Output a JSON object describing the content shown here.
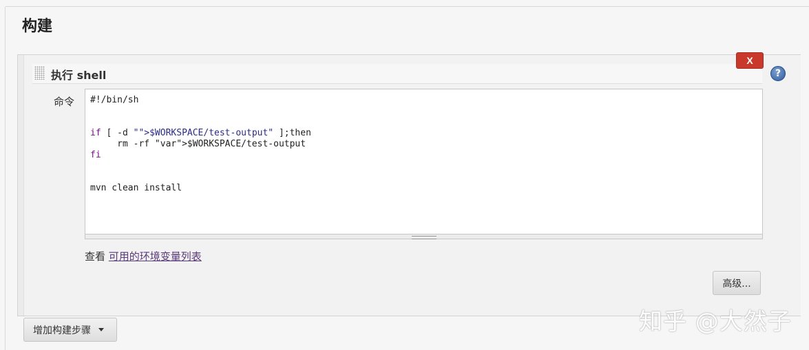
{
  "section": {
    "title": "构建"
  },
  "step": {
    "title": "执行 shell",
    "delete_label": "X",
    "help_label": "?",
    "command_label": "命令",
    "command_lines": [
      "#!/bin/sh",
      "",
      "",
      "if [ -d \"$WORKSPACE/test-output\" ];then",
      "     rm -rf $WORKSPACE/test-output",
      "fi",
      "",
      "",
      "mvn clean install"
    ],
    "env_prefix": "查看",
    "env_link": "可用的环境变量列表",
    "advanced_label": "高级..."
  },
  "add_step": {
    "label": "增加构建步骤"
  },
  "watermark": "知乎 @大然子",
  "colors": {
    "delete_button": "#c8392b",
    "help_icon": "#2e5c9e",
    "link": "#5b3a7a",
    "keyword": "#7a0e8a"
  },
  "icons": {
    "help": "question-circle-icon",
    "drag": "drag-handle-icon",
    "dropdown": "caret-down-icon"
  }
}
